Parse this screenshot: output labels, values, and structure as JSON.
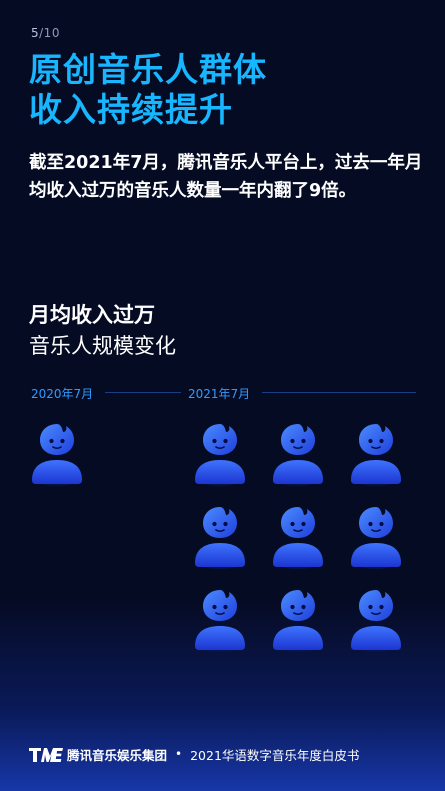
{
  "page": {
    "current": "5",
    "total": "/10"
  },
  "headline": {
    "line1": "原创音乐人群体",
    "line2": "收入持续提升"
  },
  "intro": "截至2021年7月，腾讯音乐人平台上，过去一年月均收入过万的音乐人数量一年内翻了9倍。",
  "infographic": {
    "title": "月均收入过万",
    "caption": "音乐人规模变化",
    "before": {
      "label": "2020年7月",
      "icon_count": 1
    },
    "after": {
      "label": "2021年7月",
      "icon_count": 9
    },
    "icon": "musician-person-icon",
    "colors": {
      "accent": "#18b6ff",
      "label": "#2f9bff",
      "icon_top": "#3a6bff",
      "icon_bottom": "#1f3bd8"
    }
  },
  "footer": {
    "logo_text": "TME",
    "company": "腾讯音乐娱乐集团",
    "separator": "•",
    "report": "2021华语数字音乐年度白皮书"
  }
}
